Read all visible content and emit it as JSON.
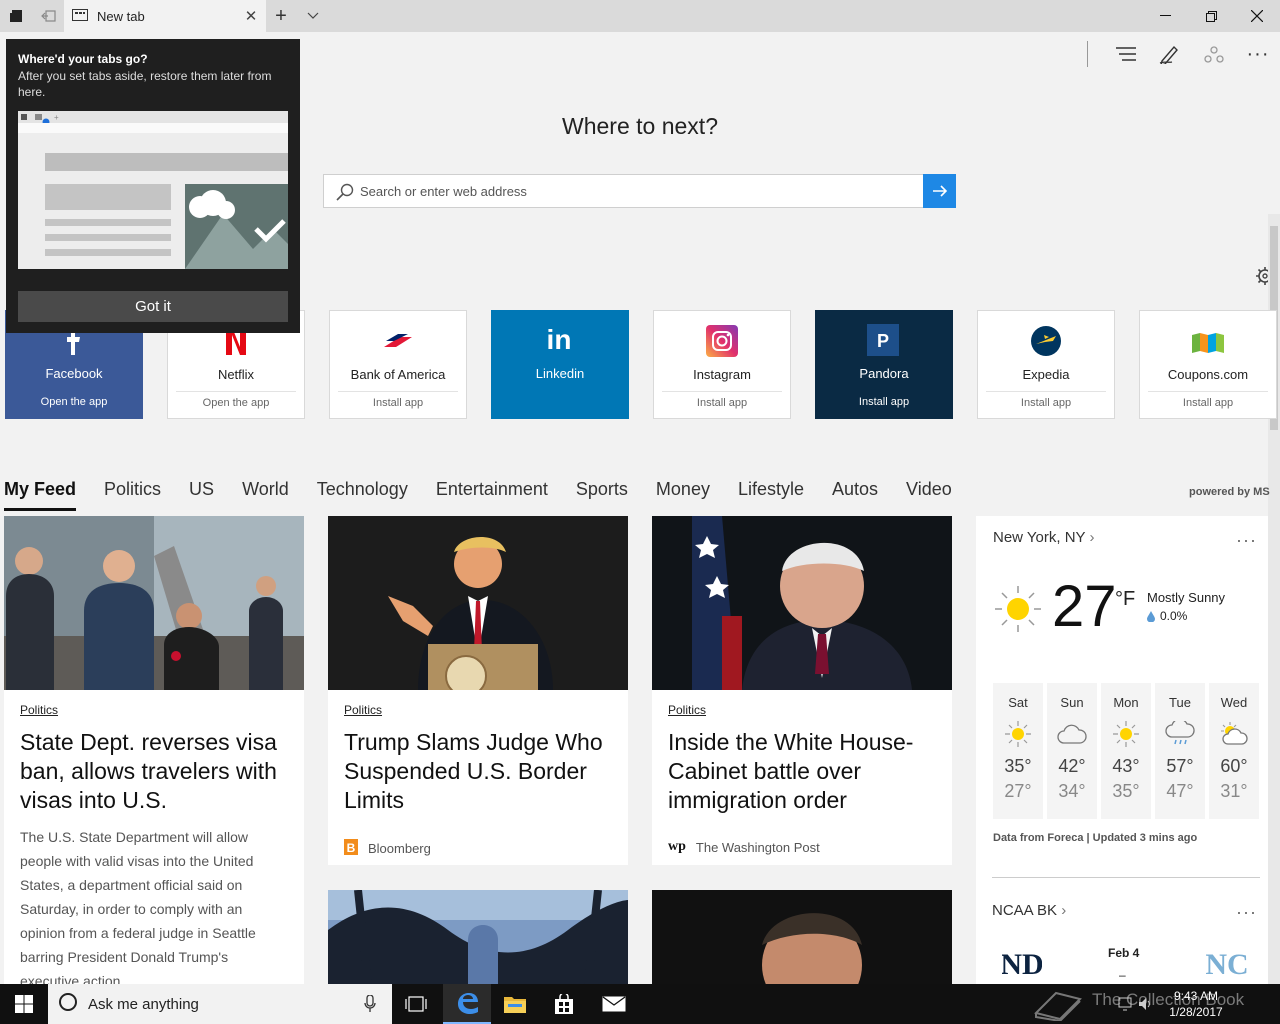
{
  "window": {
    "tab_title": "New tab",
    "minimize_icon": "minimize-icon",
    "restore_icon": "restore-icon",
    "close_icon": "close-icon"
  },
  "popup": {
    "title": "Where'd your tabs go?",
    "description": "After you set tabs aside, restore them later from here.",
    "button_label": "Got it"
  },
  "hero": {
    "title": "Where to next?",
    "search_placeholder": "Search or enter web address"
  },
  "tiles": [
    {
      "name": "Facebook",
      "action": "Open the app",
      "bg": "#3b5998"
    },
    {
      "name": "Netflix",
      "action": "Open the app",
      "bg": "#ffffff"
    },
    {
      "name": "Bank of America",
      "action": "Install app",
      "bg": "#ffffff"
    },
    {
      "name": "Linkedin",
      "action": "",
      "bg": "#0077b5"
    },
    {
      "name": "Instagram",
      "action": "Install app",
      "bg": "#ffffff"
    },
    {
      "name": "Pandora",
      "action": "Install app",
      "bg": "#0a2a44"
    },
    {
      "name": "Expedia",
      "action": "Install app",
      "bg": "#ffffff"
    },
    {
      "name": "Coupons.com",
      "action": "Install app",
      "bg": "#ffffff"
    }
  ],
  "feed": {
    "tabs": [
      "My Feed",
      "Politics",
      "US",
      "World",
      "Technology",
      "Entertainment",
      "Sports",
      "Money",
      "Lifestyle",
      "Autos",
      "Video"
    ],
    "powered_by": "powered by MS",
    "cards": [
      {
        "category": "Politics",
        "headline": "State Dept. reverses visa ban, allows travelers with visas into U.S.",
        "summary": "The U.S. State Department will allow people with valid visas into the United States, a department official said on Saturday, in order to comply with an opinion from a federal judge in Seattle barring President Donald Trump's executive action."
      },
      {
        "category": "Politics",
        "headline": "Trump Slams Judge Who Suspended U.S. Border Limits",
        "source": "Bloomberg"
      },
      {
        "category": "Politics",
        "headline": "Inside the White House-Cabinet battle over immigration order",
        "source": "The Washington Post"
      }
    ]
  },
  "weather": {
    "location": "New York, NY",
    "temperature": "27",
    "unit": "°F",
    "condition": "Mostly Sunny",
    "precip": "0.0%",
    "forecast": [
      {
        "day": "Sat",
        "hi": "35°",
        "lo": "27°",
        "icon": "sun-icon"
      },
      {
        "day": "Sun",
        "hi": "42°",
        "lo": "34°",
        "icon": "cloud-icon"
      },
      {
        "day": "Mon",
        "hi": "43°",
        "lo": "35°",
        "icon": "sun-icon"
      },
      {
        "day": "Tue",
        "hi": "57°",
        "lo": "47°",
        "icon": "rain-icon"
      },
      {
        "day": "Wed",
        "hi": "60°",
        "lo": "31°",
        "icon": "partly-cloudy-icon"
      }
    ],
    "footer": "Data from Foreca | Updated 3 mins ago",
    "sports_title": "NCAA BK",
    "game_date": "Feb 4",
    "game_separator": "–"
  },
  "taskbar": {
    "search_placeholder": "Ask me anything",
    "time": "9:43 AM",
    "date": "1/28/2017",
    "watermark": "The Collection Book"
  }
}
